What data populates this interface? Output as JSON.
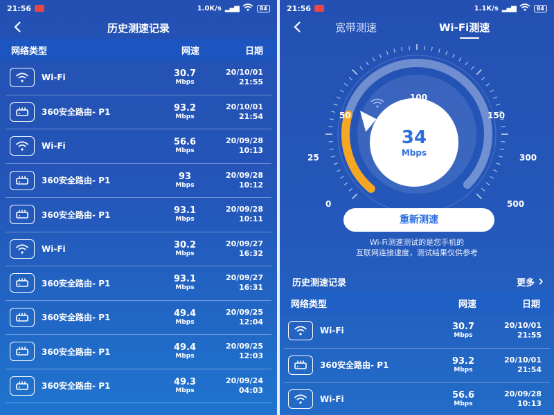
{
  "left": {
    "status": {
      "time": "21:56",
      "net": "1.0K/s",
      "battery": "84"
    },
    "title": "历史测速记录",
    "columns": {
      "type": "网络类型",
      "speed": "网速",
      "date": "日期"
    },
    "rows": [
      {
        "icon": "wifi-icon",
        "name": "Wi-Fi",
        "speed": "30.7",
        "unit": "Mbps",
        "date": "20/10/01",
        "time": "21:55"
      },
      {
        "icon": "router-icon",
        "name": "360安全路由- P1",
        "speed": "93.2",
        "unit": "Mbps",
        "date": "20/10/01",
        "time": "21:54"
      },
      {
        "icon": "wifi-icon",
        "name": "Wi-Fi",
        "speed": "56.6",
        "unit": "Mbps",
        "date": "20/09/28",
        "time": "10:13"
      },
      {
        "icon": "router-icon",
        "name": "360安全路由- P1",
        "speed": "93",
        "unit": "Mbps",
        "date": "20/09/28",
        "time": "10:12"
      },
      {
        "icon": "router-icon",
        "name": "360安全路由- P1",
        "speed": "93.1",
        "unit": "Mbps",
        "date": "20/09/28",
        "time": "10:11"
      },
      {
        "icon": "wifi-icon",
        "name": "Wi-Fi",
        "speed": "30.2",
        "unit": "Mbps",
        "date": "20/09/27",
        "time": "16:32"
      },
      {
        "icon": "router-icon",
        "name": "360安全路由- P1",
        "speed": "93.1",
        "unit": "Mbps",
        "date": "20/09/27",
        "time": "16:31"
      },
      {
        "icon": "router-icon",
        "name": "360安全路由- P1",
        "speed": "49.4",
        "unit": "Mbps",
        "date": "20/09/25",
        "time": "12:04"
      },
      {
        "icon": "router-icon",
        "name": "360安全路由- P1",
        "speed": "49.4",
        "unit": "Mbps",
        "date": "20/09/25",
        "time": "12:03"
      },
      {
        "icon": "router-icon",
        "name": "360安全路由- P1",
        "speed": "49.3",
        "unit": "Mbps",
        "date": "20/09/24",
        "time": "04:03"
      }
    ]
  },
  "right": {
    "status": {
      "time": "21:56",
      "net": "1.1K/s",
      "battery": "84"
    },
    "tabs": [
      "宽带测速",
      "Wi-Fi测速"
    ],
    "gauge": {
      "ticks": [
        "0",
        "25",
        "50",
        "100",
        "150",
        "300",
        "500"
      ],
      "value": "34",
      "unit": "Mbps",
      "accent": "#f5a623"
    },
    "retest_label": "重新测速",
    "note_line1": "Wi-Fi测速测试的是您手机的",
    "note_line2": "互联网连接速度，测试结果仅供参考",
    "history_title": "历史测速记录",
    "more_label": "更多",
    "columns": {
      "type": "网络类型",
      "speed": "网速",
      "date": "日期"
    },
    "rows": [
      {
        "icon": "wifi-icon",
        "name": "Wi-Fi",
        "speed": "30.7",
        "unit": "Mbps",
        "date": "20/10/01",
        "time": "21:55"
      },
      {
        "icon": "router-icon",
        "name": "360安全路由- P1",
        "speed": "93.2",
        "unit": "Mbps",
        "date": "20/10/01",
        "time": "21:54"
      },
      {
        "icon": "wifi-icon",
        "name": "Wi-Fi",
        "speed": "56.6",
        "unit": "Mbps",
        "date": "20/09/28",
        "time": "10:13"
      }
    ]
  }
}
